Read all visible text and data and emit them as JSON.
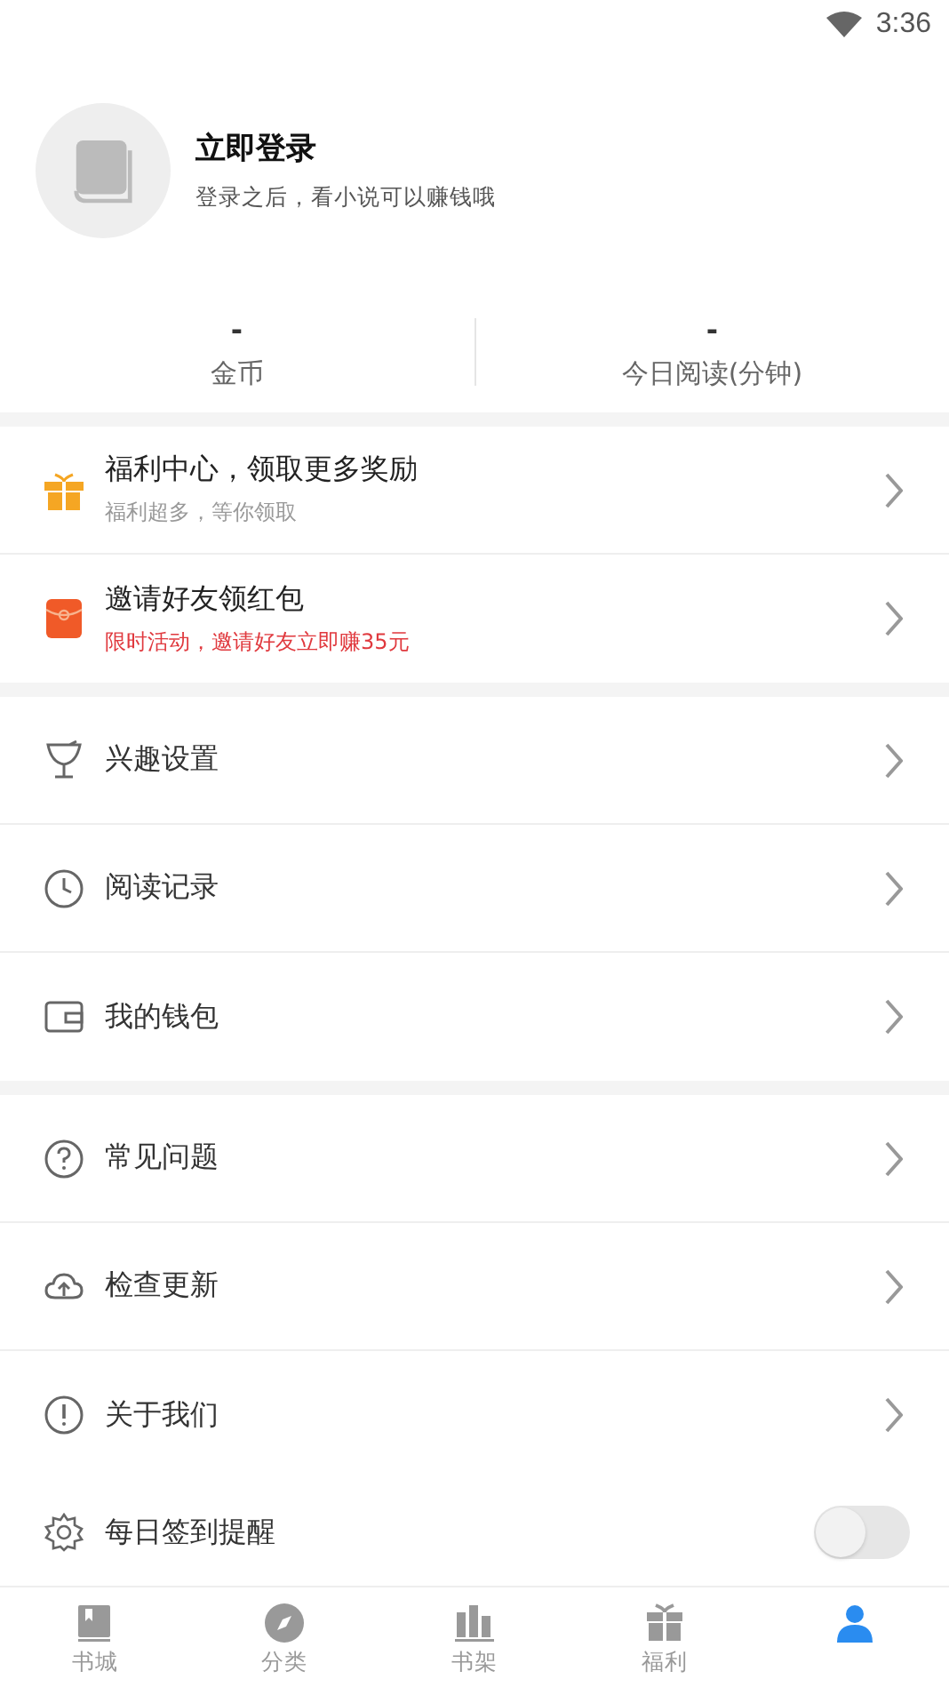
{
  "status_bar": {
    "time": "3:36"
  },
  "profile": {
    "title": "立即登录",
    "subtitle": "登录之后，看小说可以赚钱哦"
  },
  "stats": [
    {
      "value": "-",
      "label": "金币"
    },
    {
      "value": "-",
      "label": "今日阅读(分钟)"
    }
  ],
  "promos": [
    {
      "title": "福利中心，领取更多奖励",
      "subtitle": "福利超多，等你领取",
      "color": "#999999"
    },
    {
      "title": "邀请好友领红包",
      "subtitle": "限时活动，邀请好友立即赚35元",
      "color": "#e0393e"
    }
  ],
  "groups": [
    [
      {
        "label": "兴趣设置"
      },
      {
        "label": "阅读记录"
      },
      {
        "label": "我的钱包"
      }
    ],
    [
      {
        "label": "常见问题"
      },
      {
        "label": "检查更新"
      },
      {
        "label": "关于我们"
      }
    ]
  ],
  "reminder": {
    "label": "每日签到提醒",
    "on": false
  },
  "tabs": [
    {
      "label": "书城",
      "selected": false
    },
    {
      "label": "分类",
      "selected": false
    },
    {
      "label": "书架",
      "selected": false
    },
    {
      "label": "福利",
      "selected": false
    },
    {
      "selected": true
    }
  ]
}
